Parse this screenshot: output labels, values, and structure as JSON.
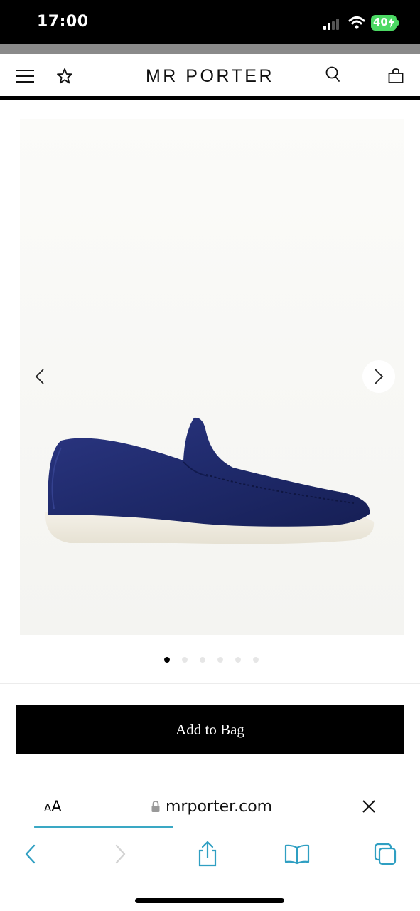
{
  "status_bar": {
    "time": "17:00",
    "battery": "40",
    "icons": [
      "cellular-signal-icon",
      "wifi-icon",
      "battery-charging-icon"
    ]
  },
  "header": {
    "logo": "MR PORTER",
    "icons": [
      "hamburger-menu-icon",
      "wishlist-star-icon",
      "search-icon",
      "shopping-bag-icon"
    ]
  },
  "gallery": {
    "image": "navy suede loafer with white sole",
    "slide_count": 6,
    "active_slide": 1,
    "icons": [
      "chevron-left-icon",
      "chevron-right-icon"
    ]
  },
  "product_actions": {
    "add_to_bag_label": "Add to Bag"
  },
  "browser": {
    "aa_small": "A",
    "aa_large": "A",
    "url": "mrporter.com",
    "load_progress": 0.36,
    "icons": [
      "lock-icon",
      "close-icon",
      "back-icon",
      "forward-icon",
      "share-icon",
      "bookmarks-icon",
      "tabs-icon"
    ]
  },
  "colors": {
    "accent_progress": "#3aa8c4",
    "shoe_navy": "#1f2a6b",
    "button_black": "#000000"
  }
}
